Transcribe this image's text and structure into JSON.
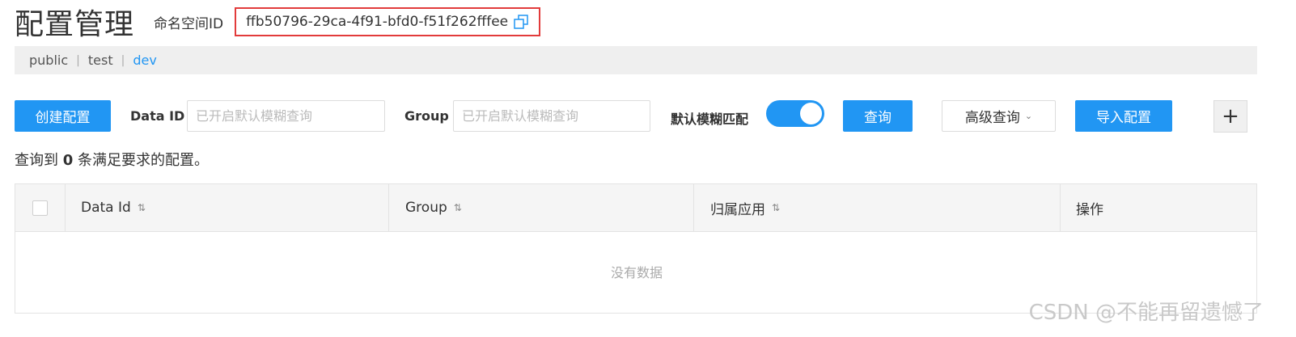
{
  "header": {
    "title": "配置管理",
    "namespace_label": "命名空间ID",
    "namespace_id": "ffb50796-29ca-4f91-bfd0-f51f262fffee"
  },
  "namespaces": [
    {
      "label": "public",
      "active": false
    },
    {
      "label": "test",
      "active": false
    },
    {
      "label": "dev",
      "active": true
    }
  ],
  "toolbar": {
    "create_label": "创建配置",
    "data_id_label": "Data ID",
    "data_id_placeholder": "已开启默认模糊查询",
    "group_label": "Group",
    "group_placeholder": "已开启默认模糊查询",
    "fuzzy_label": "默认模糊匹配",
    "fuzzy_enabled": true,
    "query_label": "查询",
    "advanced_label": "高级查询",
    "import_label": "导入配置",
    "plus_label": "+"
  },
  "result": {
    "prefix": "查询到",
    "count": "0",
    "suffix": "条满足要求的配置。"
  },
  "table": {
    "columns": [
      "Data Id",
      "Group",
      "归属应用",
      "操作"
    ],
    "empty_text": "没有数据"
  },
  "watermark": "CSDN @不能再留遗憾了",
  "colors": {
    "primary": "#2196f3",
    "highlight_border": "#e23b3b"
  }
}
